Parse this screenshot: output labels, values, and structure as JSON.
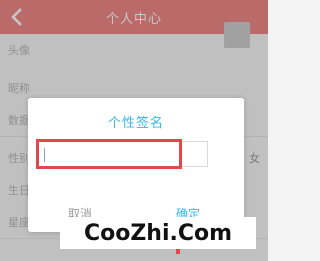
{
  "header": {
    "title": "个人中心",
    "back_icon": "back-arrow-icon",
    "bg_color": "#ef8a87"
  },
  "profile_rows": [
    {
      "label": "头像",
      "value": ""
    },
    {
      "label": "昵称",
      "value": ""
    },
    {
      "label": "数据",
      "value": ""
    },
    {
      "label": "性别",
      "value": "女"
    },
    {
      "label": "生日",
      "value": ""
    },
    {
      "label": "星座",
      "value": ""
    }
  ],
  "dialog": {
    "title": "个性签名",
    "input_value": "",
    "cancel_label": "取消",
    "confirm_label": "确定",
    "accent_color": "#38b7e8",
    "highlight_color": "#e0484a"
  },
  "watermark": {
    "text": "CooZhi.Com"
  }
}
